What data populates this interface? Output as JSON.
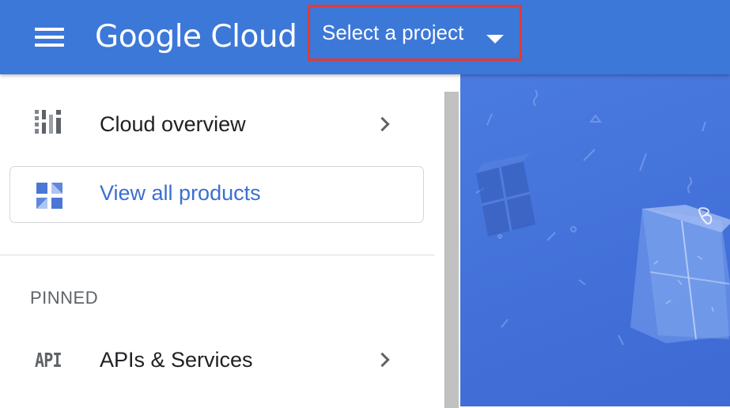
{
  "header": {
    "logo_text": "Google Cloud",
    "project_picker_label": "Select a project",
    "bar_color": "#3c78d8",
    "highlight_color": "#e53935"
  },
  "sidenav": {
    "overview_label": "Cloud overview",
    "products_label": "View all products",
    "pinned_heading": "PINNED",
    "apis_label": "APIs & Services",
    "apis_icon_text": "API",
    "products_color": "#3c6fcf"
  },
  "icons": {
    "menu": "hamburger-menu-icon",
    "dropdown": "caret-down-icon",
    "overview": "dashboard-icon",
    "products": "grid-icon",
    "apis": "api-icon",
    "chevron": "chevron-right-icon"
  },
  "background": {
    "illustration": "gift-boxes-confetti",
    "color": "#4270d8"
  }
}
